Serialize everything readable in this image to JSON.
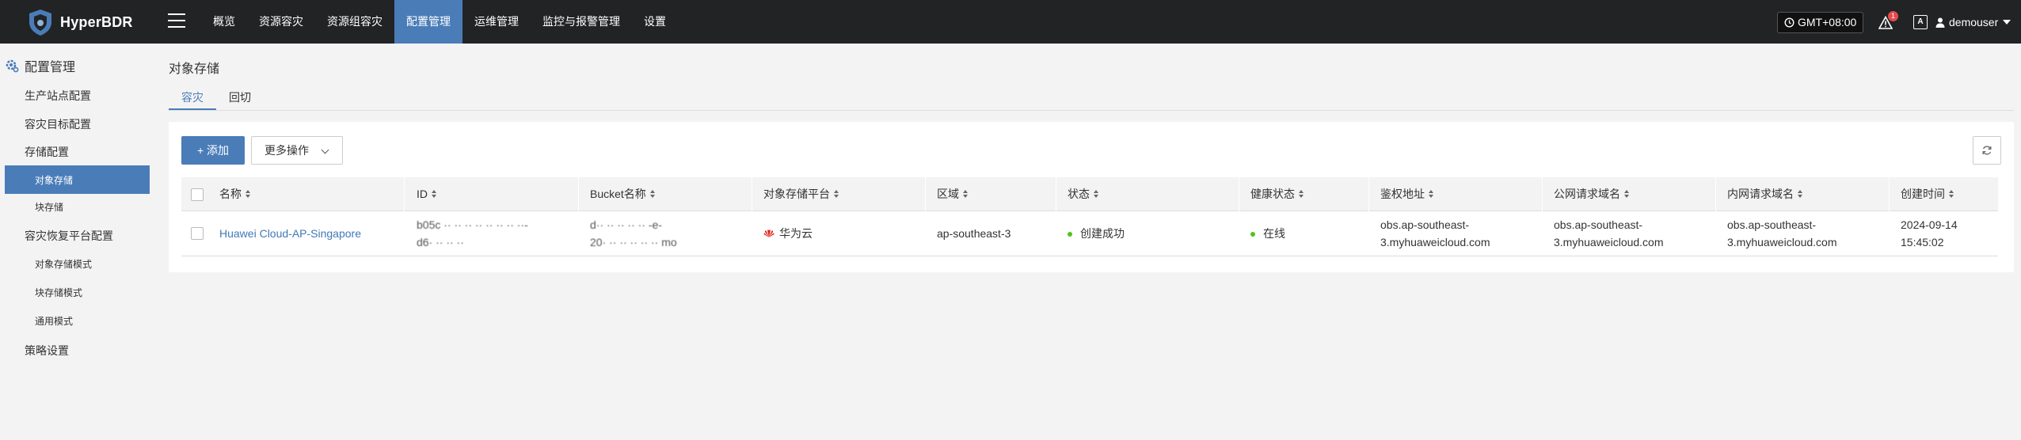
{
  "app": {
    "name": "HyperBDR"
  },
  "topnav": {
    "items": [
      "概览",
      "资源容灾",
      "资源组容灾",
      "配置管理",
      "运维管理",
      "监控与报警管理",
      "设置"
    ],
    "active_index": 3,
    "timezone": "GMT+08:00",
    "alert_count": "1",
    "lang_icon_text": "A",
    "username": "demouser"
  },
  "sidebar": {
    "title": "配置管理",
    "items": {
      "prod_site": "生产站点配置",
      "dr_target": "容灾目标配置",
      "storage": "存储配置",
      "object_storage": "对象存储",
      "block_storage": "块存储",
      "recovery_platform": "容灾恢复平台配置",
      "object_storage_mode": "对象存储模式",
      "block_storage_mode": "块存储模式",
      "generic_mode": "通用模式",
      "policy": "策略设置"
    }
  },
  "page": {
    "title": "对象存储",
    "tabs": [
      "容灾",
      "回切"
    ],
    "active_tab": 0
  },
  "toolbar": {
    "add_label": "+ 添加",
    "more_label": "更多操作"
  },
  "table": {
    "columns": [
      "名称",
      "ID",
      "Bucket名称",
      "对象存储平台",
      "区域",
      "状态",
      "健康状态",
      "鉴权地址",
      "公网请求域名",
      "内网请求域名",
      "创建时间"
    ],
    "rows": [
      {
        "name": "Huawei Cloud-AP-Singapore",
        "id_line1": "b05c ·· ·· ·· ·· ·· ·· ·· ··-",
        "id_line2": "d6· ·· ·· ··",
        "bucket_line1": "d·· ·· ·· ·· ·· -e-",
        "bucket_line2": "20· ·· ·· ·· ·· ·· mo",
        "platform": "华为云",
        "region": "ap-southeast-3",
        "status": "创建成功",
        "health": "在线",
        "auth_line1": "obs.ap-southeast-",
        "auth_line2": "3.myhuaweicloud.com",
        "public_line1": "obs.ap-southeast-",
        "public_line2": "3.myhuaweicloud.com",
        "internal_line1": "obs.ap-southeast-",
        "internal_line2": "3.myhuaweicloud.com",
        "created_line1": "2024-09-14",
        "created_line2": "15:45:02"
      }
    ]
  },
  "colors": {
    "topbar": "#222325",
    "accent": "#4a7db8",
    "link": "#3e79b6",
    "online": "#52c41a",
    "alert": "#e34c4c",
    "huawei": "#e0231a"
  }
}
